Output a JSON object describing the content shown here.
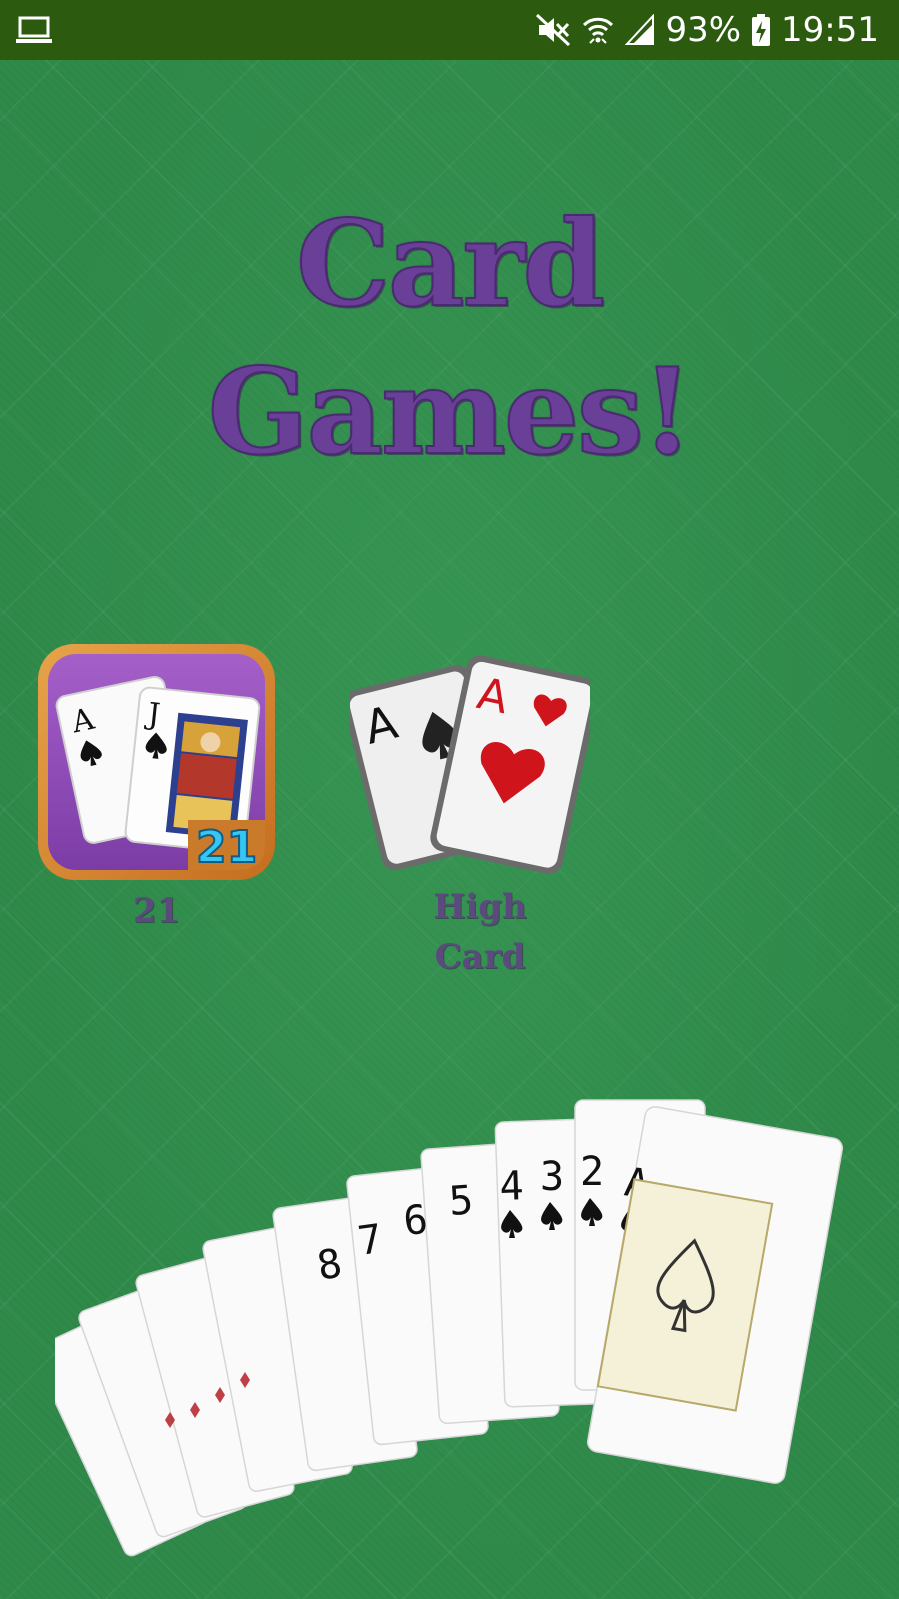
{
  "status_bar": {
    "left_icon": "laptop-icon",
    "icons": [
      "mute-vibrate-icon",
      "wifi-icon",
      "signal-icon",
      "battery-charging-icon"
    ],
    "battery": "93%",
    "time": "19:51"
  },
  "title": {
    "line1": "Card",
    "line2": "Games!"
  },
  "games": [
    {
      "label": "21",
      "icon": "blackjack-21-icon",
      "badge": "21"
    },
    {
      "label_line1": "High",
      "label_line2": "Card",
      "icon": "high-card-icon"
    }
  ],
  "colors": {
    "status_bar": "#2c5b10",
    "felt": "#2f8a4a",
    "title": "#6a3f97",
    "label": "#5c4a7e"
  }
}
